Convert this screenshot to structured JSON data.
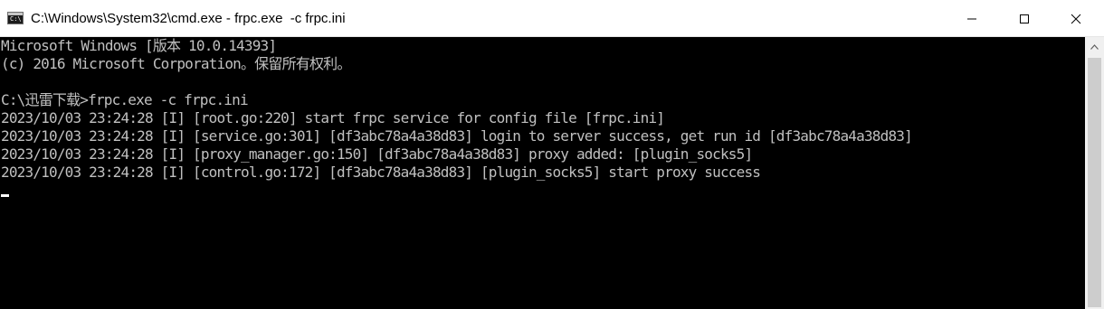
{
  "window": {
    "title": "C:\\Windows\\System32\\cmd.exe - frpc.exe  -c frpc.ini",
    "icon": "cmd-icon",
    "icon_text": "C:\\",
    "buttons": {
      "minimize": "minimize-icon",
      "maximize": "maximize-icon",
      "close": "close-icon"
    }
  },
  "console": {
    "colors": {
      "background": "#000000",
      "foreground": "#c0c0c0"
    },
    "lines": [
      "Microsoft Windows [版本 10.0.14393]",
      "(c) 2016 Microsoft Corporation。保留所有权利。",
      "",
      "C:\\迅雷下载>frpc.exe -c frpc.ini",
      "2023/10/03 23:24:28 [I] [root.go:220] start frpc service for config file [frpc.ini]",
      "2023/10/03 23:24:28 [I] [service.go:301] [df3abc78a4a38d83] login to server success, get run id [df3abc78a4a38d83]",
      "2023/10/03 23:24:28 [I] [proxy_manager.go:150] [df3abc78a4a38d83] proxy added: [plugin_socks5]",
      "2023/10/03 23:24:28 [I] [control.go:172] [df3abc78a4a38d83] [plugin_socks5] start proxy success"
    ]
  },
  "scrollbar": {
    "up_icon": "scroll-up-arrow-icon"
  }
}
